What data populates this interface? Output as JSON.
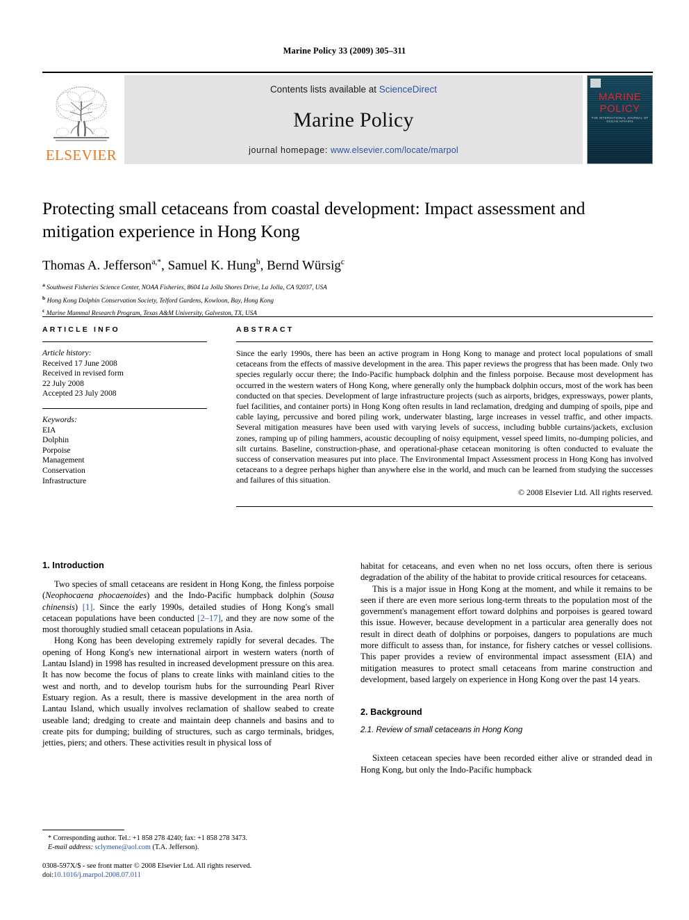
{
  "running_head": "Marine Policy 33 (2009) 305–311",
  "masthead": {
    "publisher_wordmark": "ELSEVIER",
    "contents_prefix": "Contents lists available at ",
    "contents_link": "ScienceDirect",
    "journal_name": "Marine Policy",
    "homepage_prefix": "journal homepage: ",
    "homepage_link": "www.elsevier.com/locate/marpol",
    "cover": {
      "line1": "MARINE",
      "line2": "POLICY",
      "subtitle": "THE INTERNATIONAL JOURNAL OF OCEAN AFFAIRS"
    },
    "colors": {
      "link_blue": "#2b52a3",
      "elsevier_orange": "#E87722",
      "cover_red": "#e0262b",
      "band_gray": "#e3e3e3"
    }
  },
  "article": {
    "title": "Protecting small cetaceans from coastal development: Impact assessment and mitigation experience in Hong Kong",
    "authors": "Thomas A. Jefferson a,*, Samuel K. Hung b, Bernd Würsig c",
    "authors_parts": [
      {
        "name": "Thomas A. Jefferson",
        "sup": "a,*"
      },
      {
        "name": "Samuel K. Hung",
        "sup": "b"
      },
      {
        "name": "Bernd Würsig",
        "sup": "c"
      }
    ],
    "affiliations": [
      {
        "marker": "a",
        "text": "Southwest Fisheries Science Center, NOAA Fisheries, 8604 La Jolla Shores Drive, La Jolla, CA 92037, USA"
      },
      {
        "marker": "b",
        "text": "Hong Kong Dolphin Conservation Society, Telford Gardens, Kowloon, Bay, Hong Kong"
      },
      {
        "marker": "c",
        "text": "Marine Mammal Research Program, Texas A&M University, Galveston, TX, USA"
      }
    ]
  },
  "article_info": {
    "heading": "ARTICLE INFO",
    "history_label": "Article history:",
    "history": [
      "Received 17 June 2008",
      "Received in revised form",
      "22 July 2008",
      "Accepted 23 July 2008"
    ],
    "keywords_label": "Keywords:",
    "keywords": [
      "EIA",
      "Dolphin",
      "Porpoise",
      "Management",
      "Conservation",
      "Infrastructure"
    ]
  },
  "abstract": {
    "heading": "ABSTRACT",
    "text": "Since the early 1990s, there has been an active program in Hong Kong to manage and protect local populations of small cetaceans from the effects of massive development in the area. This paper reviews the progress that has been made. Only two species regularly occur there; the Indo-Pacific humpback dolphin and the finless porpoise. Because most development has occurred in the western waters of Hong Kong, where generally only the humpback dolphin occurs, most of the work has been conducted on that species. Development of large infrastructure projects (such as airports, bridges, expressways, power plants, fuel facilities, and container ports) in Hong Kong often results in land reclamation, dredging and dumping of spoils, pipe and cable laying, percussive and bored piling work, underwater blasting, large increases in vessel traffic, and other impacts. Several mitigation measures have been used with varying levels of success, including bubble curtains/jackets, exclusion zones, ramping up of piling hammers, acoustic decoupling of noisy equipment, vessel speed limits, no-dumping policies, and silt curtains. Baseline, construction-phase, and operational-phase cetacean monitoring is often conducted to evaluate the success of conservation measures put into place. The Environmental Impact Assessment process in Hong Kong has involved cetaceans to a degree perhaps higher than anywhere else in the world, and much can be learned from studying the successes and failures of this situation.",
    "copyright": "© 2008 Elsevier Ltd. All rights reserved."
  },
  "body": {
    "section1_heading": "1. Introduction",
    "para1_a": "Two species of small cetaceans are resident in Hong Kong, the finless porpoise (",
    "para1_sp1": "Neophocaena phocaenoides",
    "para1_b": ") and the Indo-Pacific humpback dolphin (",
    "para1_sp2": "Sousa chinensis",
    "para1_c": ") ",
    "para1_cite1": "[1]",
    "para1_d": ". Since the early 1990s, detailed studies of Hong Kong's small cetacean populations have been conducted ",
    "para1_cite2": "[2–17]",
    "para1_e": ", and they are now some of the most thoroughly studied small cetacean populations in Asia.",
    "para2": "Hong Kong has been developing extremely rapidly for several decades. The opening of Hong Kong's new international airport in western waters (north of Lantau Island) in 1998 has resulted in increased development pressure on this area. It has now become the focus of plans to create links with mainland cities to the west and north, and to develop tourism hubs for the surrounding Pearl River Estuary region. As a result, there is massive development in the area north of Lantau Island, which usually involves reclamation of shallow seabed to create useable land; dredging to create and maintain deep channels and basins and to create pits for dumping; building of structures, such as cargo terminals, bridges, jetties, piers; and others. These activities result in physical loss of",
    "para3": "habitat for cetaceans, and even when no net loss occurs, often there is serious degradation of the ability of the habitat to provide critical resources for cetaceans.",
    "para4": "This is a major issue in Hong Kong at the moment, and while it remains to be seen if there are even more serious long-term threats to the population most of the government's management effort toward dolphins and porpoises is geared toward this issue. However, because development in a particular area generally does not result in direct death of dolphins or porpoises, dangers to populations are much more difficult to assess than, for instance, for fishery catches or vessel collisions. This paper provides a review of environmental impact assessment (EIA) and mitigation measures to protect small cetaceans from marine construction and development, based largely on experience in Hong Kong over the past 14 years.",
    "section2_heading": "2. Background",
    "subsection21_heading": "2.1. Review of small cetaceans in Hong Kong",
    "para5": "Sixteen cetacean species have been recorded either alive or stranded dead in Hong Kong, but only the Indo-Pacific humpback"
  },
  "footnotes": {
    "corresponding": "* Corresponding author. Tel.: +1 858 278 4240; fax: +1 858 278 3473.",
    "email_label": "E-mail address:",
    "email": "sclymene@aol.com",
    "email_attrib": "(T.A. Jefferson).",
    "issn_line": "0308-597X/$ - see front matter © 2008 Elsevier Ltd. All rights reserved.",
    "doi_label": "doi:",
    "doi_value": "10.1016/j.marpol.2008.07.011"
  }
}
